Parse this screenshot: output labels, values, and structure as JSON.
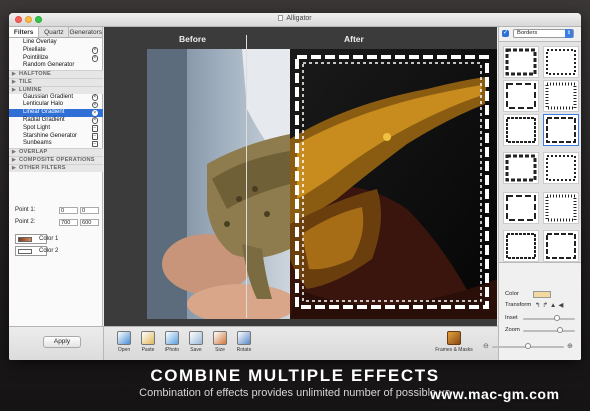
{
  "window": {
    "title": "Alligator"
  },
  "sidebar": {
    "tabs": [
      {
        "label": "Filters",
        "active": true
      },
      {
        "label": "Quartz",
        "active": false
      },
      {
        "label": "Generators",
        "active": false
      }
    ],
    "items": [
      {
        "type": "item",
        "label": "Line Overlay"
      },
      {
        "type": "item",
        "label": "Pixellate",
        "icon": "x-circle-icon"
      },
      {
        "type": "item",
        "label": "Pointillize",
        "icon": "x-circle-icon"
      },
      {
        "type": "item",
        "label": "Random Generator"
      },
      {
        "type": "category",
        "label": "HALFTONE"
      },
      {
        "type": "category",
        "label": "TILE"
      },
      {
        "type": "category",
        "label": "LUMINE"
      },
      {
        "type": "item",
        "label": "Gaussian Gradient",
        "icon": "x-circle-icon"
      },
      {
        "type": "item",
        "label": "Lenticular Halo",
        "icon": "x-circle-icon"
      },
      {
        "type": "item",
        "label": "Linear Gradient",
        "icon": "x-circle-icon",
        "selected": true
      },
      {
        "type": "item",
        "label": "Radial Gradient",
        "icon": "x-circle-icon"
      },
      {
        "type": "item",
        "label": "Spot Light",
        "icon": "minus-box-icon"
      },
      {
        "type": "item",
        "label": "Starshine Generator",
        "icon": "minus-box-icon"
      },
      {
        "type": "item",
        "label": "Sunbeams",
        "icon": "minus-box-icon"
      },
      {
        "type": "category",
        "label": "OVERLAP"
      },
      {
        "type": "category",
        "label": "COMPOSITE OPERATIONS"
      },
      {
        "type": "category",
        "label": "OTHER FILTERS"
      }
    ],
    "params": {
      "point1_label": "Point 1:",
      "point1_x": "0",
      "point1_y": "0",
      "point2_label": "Point 2:",
      "point2_x": "700",
      "point2_y": "600",
      "color1_label": "Color 1",
      "color2_label": "Color 2"
    },
    "apply_label": "Apply"
  },
  "canvas": {
    "before_label": "Before",
    "after_label": "After"
  },
  "right_panel": {
    "borders_checked": true,
    "borders_select": "Borders",
    "color_label": "Color",
    "transform_label": "Transform",
    "inset_label": "Inset",
    "zoom_label": "Zoom",
    "inset_value": 0.65,
    "zoom_value": 0.72
  },
  "toolbar": {
    "buttons": [
      {
        "label": "Open",
        "icon": "open-icon"
      },
      {
        "label": "Paste",
        "icon": "paste-icon"
      },
      {
        "label": "iPhoto",
        "icon": "iphoto-icon"
      },
      {
        "label": "Save",
        "icon": "save-icon"
      },
      {
        "label": "Size",
        "icon": "size-icon"
      },
      {
        "label": "Rotate",
        "icon": "rotate-icon"
      }
    ],
    "frames_label": "Frames & Masks",
    "zoom_value": 0.5
  },
  "caption": {
    "headline": "COMBINE MULTIPLE EFFECTS",
    "subline": "Combination of effects provides unlimited number of possible va",
    "watermark": "www.mac-gm.com"
  },
  "colors": {
    "accent": "#2f6fd6",
    "selection": "#3d7ee3",
    "color1": "#7a3b1f",
    "color2": "#ffffff",
    "border_color": "#f2d9a0"
  }
}
